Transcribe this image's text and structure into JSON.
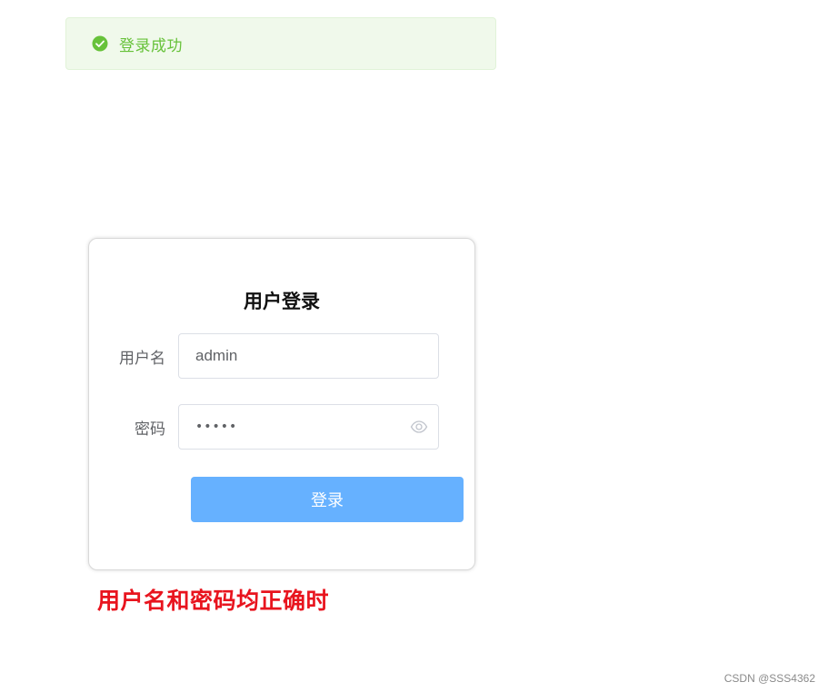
{
  "message": {
    "text": "登录成功",
    "icon": "success-check-icon",
    "color": "#67c23a"
  },
  "login": {
    "title": "用户登录",
    "username_label": "用户名",
    "username_value": "admin",
    "password_label": "密码",
    "password_value": "•••••",
    "password_toggle_icon": "eye-icon",
    "submit_label": "登录",
    "button_color": "#66b1ff"
  },
  "annotation": {
    "text": "用户名和密码均正确时",
    "color": "#e8141e"
  },
  "watermark": {
    "text": "CSDN @SSS4362"
  }
}
